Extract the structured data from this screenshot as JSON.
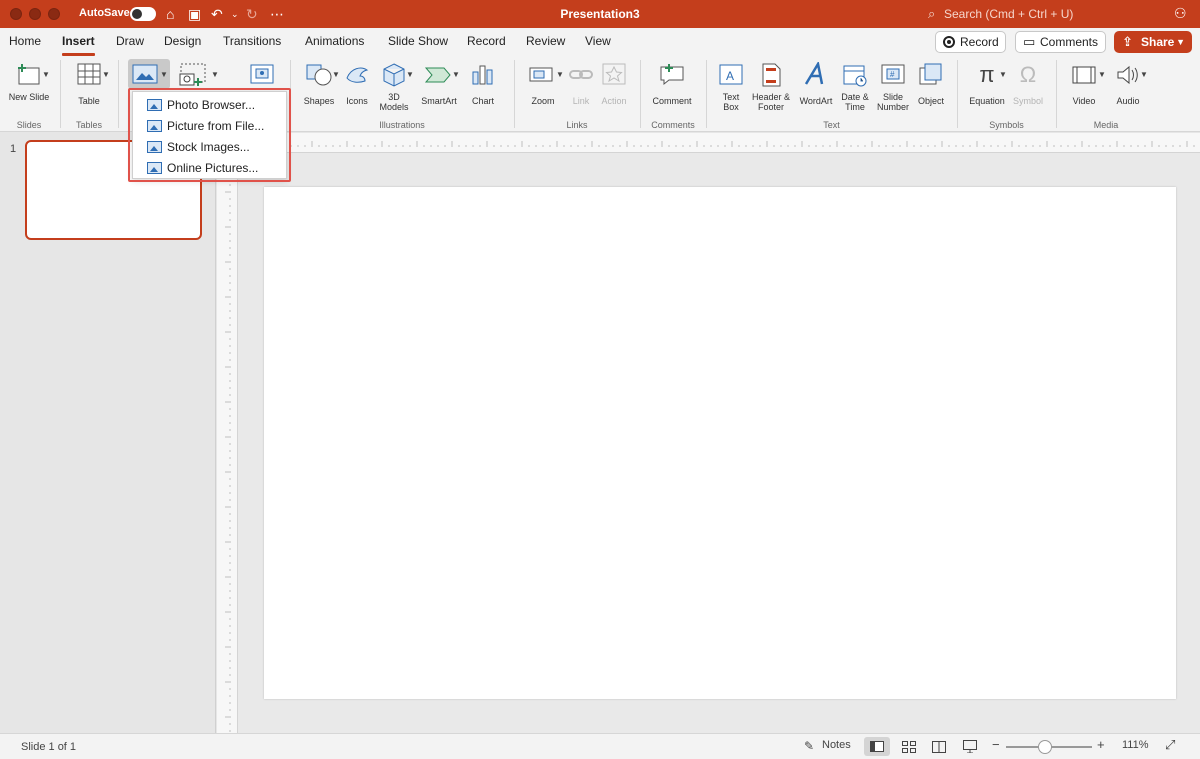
{
  "window": {
    "title": "Presentation3",
    "autosave_label": "AutoSave",
    "search_placeholder": "Search (Cmd + Ctrl + U)"
  },
  "tabs": [
    "Home",
    "Insert",
    "Draw",
    "Design",
    "Transitions",
    "Animations",
    "Slide Show",
    "Record",
    "Review",
    "View"
  ],
  "active_tab": "Insert",
  "header_buttons": {
    "record": "Record",
    "comments": "Comments",
    "share": "Share"
  },
  "ribbon": {
    "new_slide": "New Slide",
    "table": "Table",
    "shapes": "Shapes",
    "icons": "Icons",
    "models_3d": "3D Models",
    "smartart": "SmartArt",
    "chart": "Chart",
    "zoom": "Zoom",
    "link": "Link",
    "action": "Action",
    "comment": "Comment",
    "text_box": "Text Box",
    "header_footer": "Header & Footer",
    "wordart": "WordArt",
    "date_time": "Date & Time",
    "slide_number": "Slide Number",
    "object": "Object",
    "equation": "Equation",
    "symbol": "Symbol",
    "video": "Video",
    "audio": "Audio"
  },
  "groups": {
    "slides": "Slides",
    "tables": "Tables",
    "illustrations": "Illustrations",
    "links": "Links",
    "comments": "Comments",
    "text": "Text",
    "symbols": "Symbols",
    "media": "Media"
  },
  "picture_menu": [
    "Photo Browser...",
    "Picture from File...",
    "Stock Images...",
    "Online Pictures..."
  ],
  "thumbnail_number": "1",
  "status": {
    "slide_info": "Slide 1 of 1",
    "notes": "Notes",
    "zoom_percent": "111%",
    "zoom_fraction": 0.45
  },
  "colors": {
    "accent": "#c43e1c",
    "highlight": "#e0524a"
  }
}
